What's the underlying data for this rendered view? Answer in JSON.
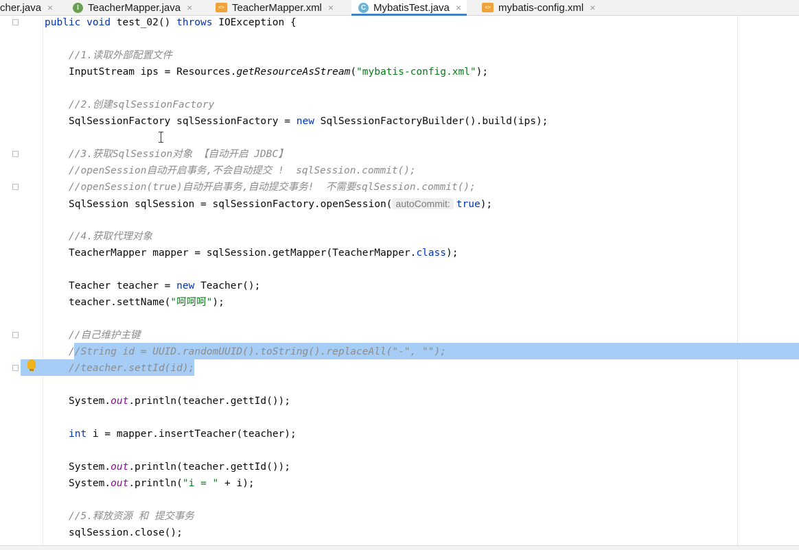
{
  "tabs": [
    {
      "label": "cher.java",
      "icon": "none"
    },
    {
      "label": "TeacherMapper.java",
      "icon": "interface-file-icon"
    },
    {
      "label": "TeacherMapper.xml",
      "icon": "xml-file-icon"
    },
    {
      "label": "MybatisTest.java",
      "icon": "class-file-icon",
      "active": true
    },
    {
      "label": "mybatis-config.xml",
      "icon": "xml-file-icon"
    }
  ],
  "tab_close_glyph": "×",
  "icon_glyphs": {
    "interface": "I",
    "class": "C",
    "xml": "<>"
  },
  "code": {
    "method_sig": {
      "kw_public": "public",
      "kw_void": "void",
      "name": "test_02()",
      "kw_throws": "throws",
      "rest": "IOException {"
    },
    "c1": "//1.读取外部配置文件",
    "l1": {
      "a": "InputStream ips = Resources.",
      "m": "getResourceAsStream",
      "b": "(",
      "s": "\"mybatis-config.xml\"",
      "c": ");"
    },
    "c2": "//2.创建sqlSessionFactory",
    "l2": {
      "a": "SqlSessionFactory sqlSessionFactory = ",
      "kw": "new",
      "b": " SqlSessionFactoryBuilder().build(ips);"
    },
    "c3": "//3.获取SqlSession对象 【自动开启 JDBC】",
    "c3b": "//openSession自动开启事务,不会自动提交 !  sqlSession.commit();",
    "c3c": "//openSession(true)自动开启事务,自动提交事务!  不需要sqlSession.commit();",
    "l3": {
      "a": "SqlSession sqlSession = sqlSessionFactory.openSession(",
      "hint": "autoCommit:",
      "kw": "true",
      "b": ");"
    },
    "c4": "//4.获取代理对象",
    "l4": {
      "a": "TeacherMapper mapper = sqlSession.getMapper(TeacherMapper.",
      "kw": "class",
      "b": ");"
    },
    "l5": {
      "a": "Teacher teacher = ",
      "kw": "new",
      "b": " Teacher();"
    },
    "l6": {
      "a": "teacher.settName(",
      "s": "\"呵呵呵\"",
      "b": ");"
    },
    "c5": "//自己维护主键",
    "c6": "//String id = UUID.randomUUID().toString().replaceAll(\"-\", \"\");",
    "c7": "//teacher.settId(id);",
    "l7": {
      "a": "System.",
      "f": "out",
      "b": ".println(teacher.gettId());"
    },
    "l8": {
      "kw": "int",
      "b": " i = mapper.insertTeacher(teacher);"
    },
    "l9": {
      "a": "System.",
      "f": "out",
      "b": ".println(teacher.gettId());"
    },
    "l10": {
      "a": "System.",
      "f": "out",
      "b": ".println(",
      "s": "\"i = \"",
      "c": " + i);"
    },
    "c8": "//5.释放资源 和 提交事务",
    "l11": "sqlSession.close();"
  }
}
